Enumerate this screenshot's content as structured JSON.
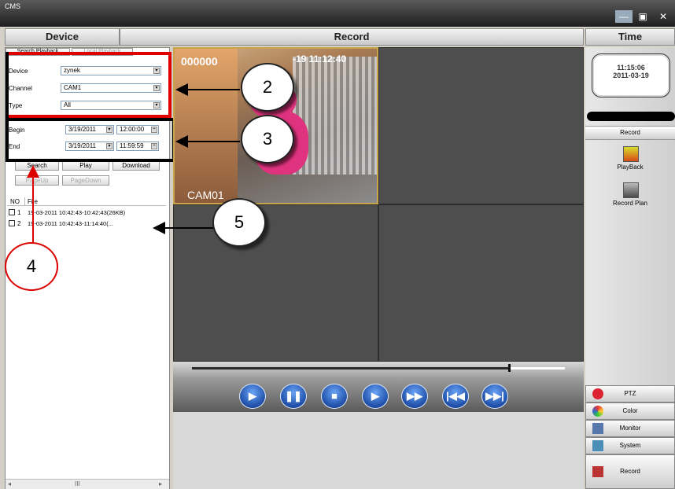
{
  "window": {
    "title": "CMS",
    "min": "—",
    "max": "▣",
    "close": "✕"
  },
  "headers": {
    "device": "Device",
    "record": "Record",
    "time": "Time"
  },
  "tabs": [
    "Search Playback",
    "Local Playback"
  ],
  "form": {
    "device_label": "Device",
    "device_value": "zynek",
    "channel_label": "Channel",
    "channel_value": "CAM1",
    "type_label": "Type",
    "type_value": "All",
    "begin_label": "Begin",
    "begin_date": "3/19/2011",
    "begin_time": "12:00:00",
    "end_label": "End",
    "end_date": "3/19/2011",
    "end_time": "11:59:59"
  },
  "buttons": {
    "search": "Search",
    "play": "Play",
    "download": "Download",
    "pageup": "PageUp",
    "pagedown": "PageDown"
  },
  "file_list": {
    "headers": [
      "NO",
      "File"
    ],
    "rows": [
      {
        "no": "1",
        "file": "19-03-2011 10:42:43-10:42:43(26KB)"
      },
      {
        "no": "2",
        "file": "19-03-2011 10:42:43-11:14:40(..."
      }
    ]
  },
  "scrollbar": {
    "dots": "III",
    "left": "◂",
    "right": "▸"
  },
  "video": {
    "timestamp": "000000",
    "overlay_date": "-19 11:12:40",
    "cam_label": "CAM01"
  },
  "clock": {
    "time": "11:15:06",
    "date": "2011-03-19"
  },
  "right_panel": {
    "record": "Record",
    "playback": "PlayBack",
    "record_plan": "Record Plan"
  },
  "bottom_menu": [
    "PTZ",
    "Color",
    "Monitor",
    "System",
    "Record"
  ],
  "callouts": [
    "2",
    "3",
    "4",
    "5"
  ],
  "playback_progress": 0.85,
  "colors": {
    "red_box": "#e00000",
    "black_box": "#000000"
  }
}
